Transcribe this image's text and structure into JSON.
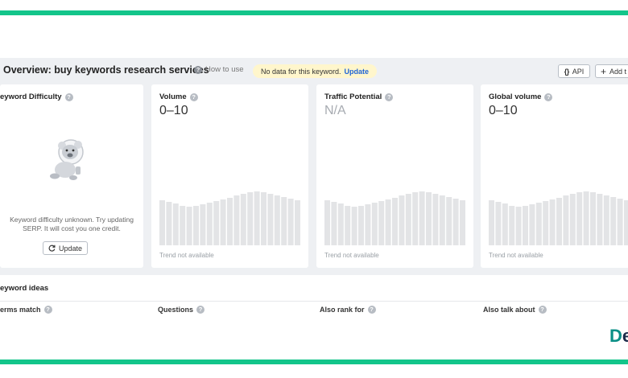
{
  "overview": {
    "title": "Overview: buy keywords research services",
    "how_to_use": "How to use",
    "no_data_text": "No data for this keyword.",
    "no_data_link": "Update",
    "api_label": "API",
    "add_label": "Add t"
  },
  "cards": {
    "kd": {
      "title": "eyword Difficulty",
      "message_line1": "Keyword difficulty unknown. Try updating",
      "message_line2": "SERP. It will cost you one credit.",
      "update_button": "Update"
    },
    "volume": {
      "title": "Volume",
      "value": "0–10",
      "trend": "Trend not available"
    },
    "traffic": {
      "title": "Traffic Potential",
      "value": "N/A",
      "trend": "Trend not available"
    },
    "global": {
      "title": "Global volume",
      "value": "0–10",
      "trend": "Trend not available"
    }
  },
  "ideas": {
    "title": "eyword ideas",
    "columns": [
      "erms match",
      "Questions",
      "Also rank for",
      "Also talk about"
    ]
  },
  "logo": {
    "text_a": "D",
    "text_b": "e"
  },
  "colors": {
    "accent_green": "#13c58a",
    "link_blue": "#1f64d6",
    "panel_bg": "#eef0f3",
    "bar_gray": "#e3e4e6",
    "highlight_yellow": "#fff6cc"
  }
}
